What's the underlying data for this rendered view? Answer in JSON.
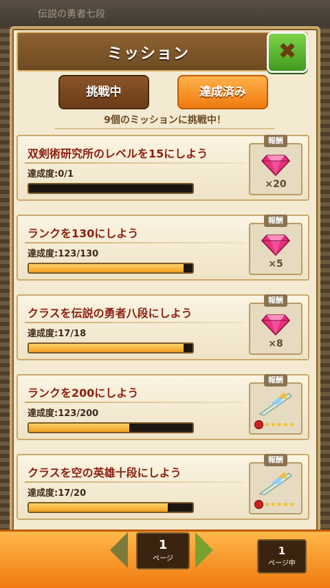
{
  "background": {
    "title_text": "伝説の勇者七段"
  },
  "header": {
    "title": "ミッション",
    "close_label": "✖"
  },
  "tabs": [
    {
      "label": "挑戦中",
      "active": true
    },
    {
      "label": "達成済み",
      "active": false
    }
  ],
  "status_text": "9個のミッションに挑戦中！",
  "reward_tag": "報酬",
  "missions": [
    {
      "title": "双剣術研究所のレベルを15にしよう",
      "progress_text": "達成度:0/1",
      "progress": 0.0,
      "reward": {
        "icon": "gem-icon",
        "count": "×20"
      }
    },
    {
      "title": "ランクを130にしよう",
      "progress_text": "達成度:123/130",
      "progress": 0.946,
      "reward": {
        "icon": "gem-icon",
        "count": "×5"
      }
    },
    {
      "title": "クラスを伝説の勇者八段にしよう",
      "progress_text": "達成度:17/18",
      "progress": 0.944,
      "reward": {
        "icon": "gem-icon",
        "count": "×8"
      }
    },
    {
      "title": "ランクを200にしよう",
      "progress_text": "達成度:123/200",
      "progress": 0.615,
      "reward": {
        "icon": "weapon-icon",
        "count": ""
      }
    },
    {
      "title": "クラスを空の英雄十段にしよう",
      "progress_text": "達成度:17/20",
      "progress": 0.85,
      "reward": {
        "icon": "weapon-icon",
        "count": ""
      }
    }
  ],
  "footer": {
    "page": "1",
    "page_unit": "ページ",
    "current_page": "1",
    "current_page_unit": "ページ中"
  },
  "colors": {
    "accent": "#f07a10",
    "title_text": "#8c1e10",
    "close": "#3f9a1e"
  }
}
